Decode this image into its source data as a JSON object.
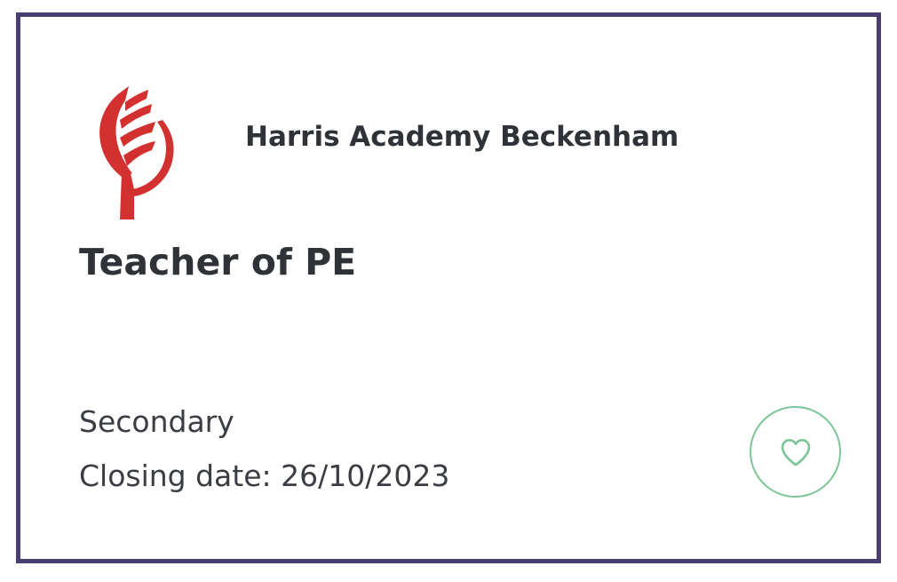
{
  "job_card": {
    "school_name": "Harris Academy Beckenham",
    "title": "Teacher of PE",
    "phase": "Secondary",
    "closing_label": "Closing date:",
    "closing_date": "26/10/2023",
    "favourite_icon": "heart-icon"
  },
  "colors": {
    "card_border": "#4a3f70",
    "logo_red": "#d2312f",
    "favourite_green": "#7cc597",
    "text_dark": "#2f3337"
  }
}
